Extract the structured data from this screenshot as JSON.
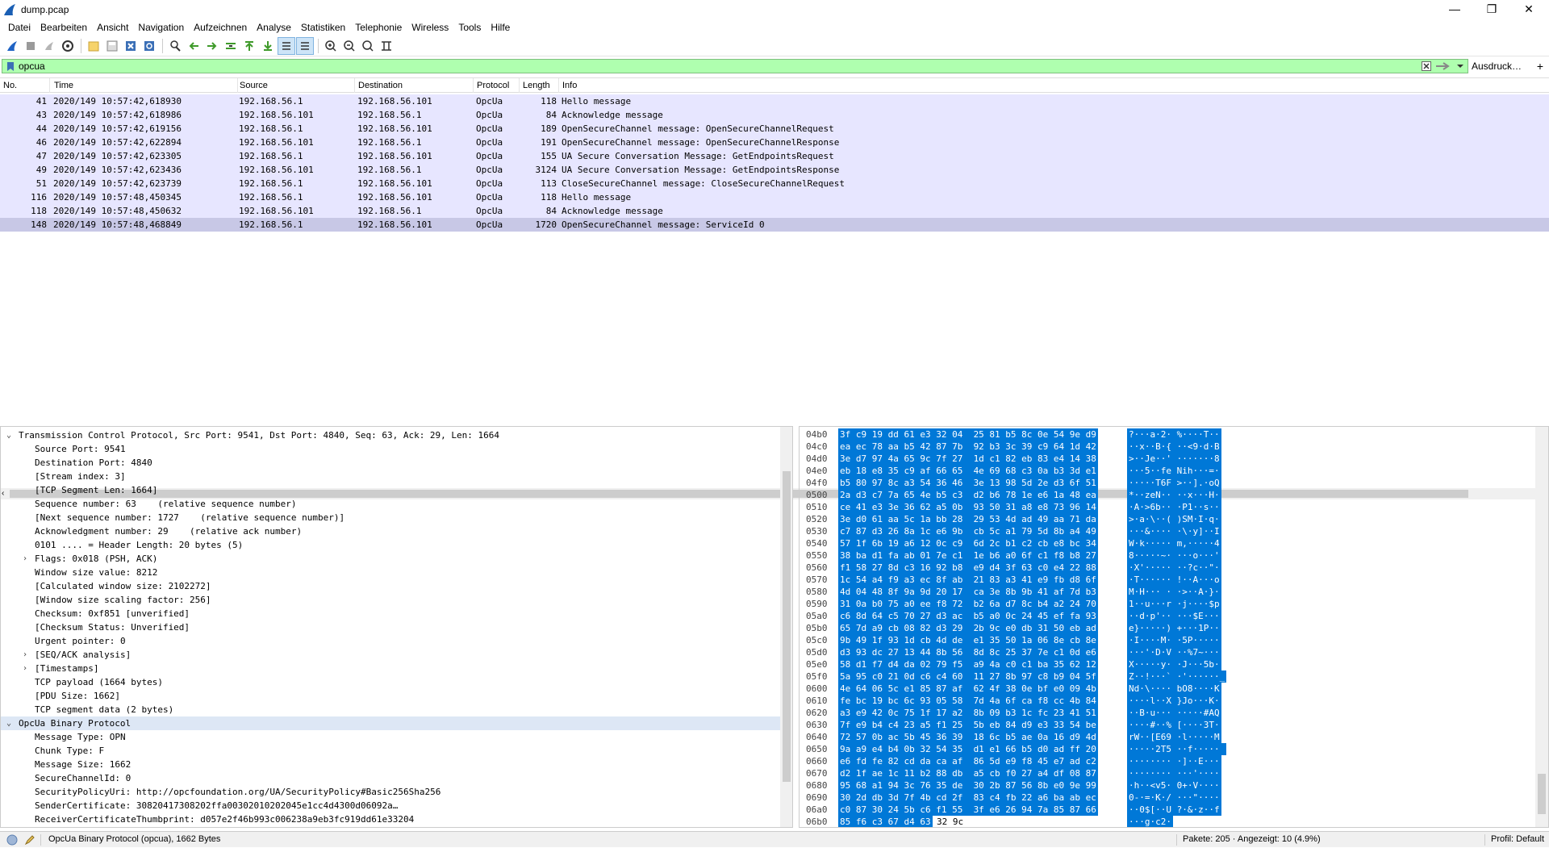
{
  "window": {
    "title": "dump.pcap",
    "minimize": "—",
    "restore": "❐",
    "close": "✕"
  },
  "menu": [
    "Datei",
    "Bearbeiten",
    "Ansicht",
    "Navigation",
    "Aufzeichnen",
    "Analyse",
    "Statistiken",
    "Telephonie",
    "Wireless",
    "Tools",
    "Hilfe"
  ],
  "filter": {
    "value": "opcua",
    "expression_label": "Ausdruck…",
    "plus": "+"
  },
  "packet_list": {
    "columns": [
      "No.",
      "Time",
      "Source",
      "Destination",
      "Protocol",
      "Length",
      "Info"
    ],
    "rows": [
      {
        "no": "41",
        "time": "2020/149 10:57:42,618930",
        "src": "192.168.56.1",
        "dst": "192.168.56.101",
        "proto": "OpcUa",
        "len": "118",
        "info": "Hello message"
      },
      {
        "no": "43",
        "time": "2020/149 10:57:42,618986",
        "src": "192.168.56.101",
        "dst": "192.168.56.1",
        "proto": "OpcUa",
        "len": "84",
        "info": "Acknowledge message"
      },
      {
        "no": "44",
        "time": "2020/149 10:57:42,619156",
        "src": "192.168.56.1",
        "dst": "192.168.56.101",
        "proto": "OpcUa",
        "len": "189",
        "info": "OpenSecureChannel message: OpenSecureChannelRequest"
      },
      {
        "no": "46",
        "time": "2020/149 10:57:42,622894",
        "src": "192.168.56.101",
        "dst": "192.168.56.1",
        "proto": "OpcUa",
        "len": "191",
        "info": "OpenSecureChannel message: OpenSecureChannelResponse"
      },
      {
        "no": "47",
        "time": "2020/149 10:57:42,623305",
        "src": "192.168.56.1",
        "dst": "192.168.56.101",
        "proto": "OpcUa",
        "len": "155",
        "info": "UA Secure Conversation Message: GetEndpointsRequest"
      },
      {
        "no": "49",
        "time": "2020/149 10:57:42,623436",
        "src": "192.168.56.101",
        "dst": "192.168.56.1",
        "proto": "OpcUa",
        "len": "3124",
        "info": "UA Secure Conversation Message: GetEndpointsResponse"
      },
      {
        "no": "51",
        "time": "2020/149 10:57:42,623739",
        "src": "192.168.56.1",
        "dst": "192.168.56.101",
        "proto": "OpcUa",
        "len": "113",
        "info": "CloseSecureChannel message: CloseSecureChannelRequest"
      },
      {
        "no": "116",
        "time": "2020/149 10:57:48,450345",
        "src": "192.168.56.1",
        "dst": "192.168.56.101",
        "proto": "OpcUa",
        "len": "118",
        "info": "Hello message"
      },
      {
        "no": "118",
        "time": "2020/149 10:57:48,450632",
        "src": "192.168.56.101",
        "dst": "192.168.56.1",
        "proto": "OpcUa",
        "len": "84",
        "info": "Acknowledge message"
      },
      {
        "no": "148",
        "time": "2020/149 10:57:48,468849",
        "src": "192.168.56.1",
        "dst": "192.168.56.101",
        "proto": "OpcUa",
        "len": "1720",
        "info": "OpenSecureChannel message: ServiceId 0"
      }
    ]
  },
  "details": [
    {
      "text": "Transmission Control Protocol, Src Port: 9541, Dst Port: 4840, Seq: 63, Ack: 29, Len: 1664",
      "level": 0,
      "arrow": "down"
    },
    {
      "text": "Source Port: 9541",
      "level": 1
    },
    {
      "text": "Destination Port: 4840",
      "level": 1
    },
    {
      "text": "[Stream index: 3]",
      "level": 1
    },
    {
      "text": "[TCP Segment Len: 1664]",
      "level": 1
    },
    {
      "text": "Sequence number: 63    (relative sequence number)",
      "level": 1
    },
    {
      "text": "[Next sequence number: 1727    (relative sequence number)]",
      "level": 1
    },
    {
      "text": "Acknowledgment number: 29    (relative ack number)",
      "level": 1
    },
    {
      "text": "0101 .... = Header Length: 20 bytes (5)",
      "level": 1
    },
    {
      "text": "Flags: 0x018 (PSH, ACK)",
      "level": 1,
      "arrow": "right"
    },
    {
      "text": "Window size value: 8212",
      "level": 1
    },
    {
      "text": "[Calculated window size: 2102272]",
      "level": 1
    },
    {
      "text": "[Window size scaling factor: 256]",
      "level": 1
    },
    {
      "text": "Checksum: 0xf851 [unverified]",
      "level": 1
    },
    {
      "text": "[Checksum Status: Unverified]",
      "level": 1
    },
    {
      "text": "Urgent pointer: 0",
      "level": 1
    },
    {
      "text": "[SEQ/ACK analysis]",
      "level": 1,
      "arrow": "right"
    },
    {
      "text": "[Timestamps]",
      "level": 1,
      "arrow": "right"
    },
    {
      "text": "TCP payload (1664 bytes)",
      "level": 1
    },
    {
      "text": "[PDU Size: 1662]",
      "level": 1
    },
    {
      "text": "TCP segment data (2 bytes)",
      "level": 1
    },
    {
      "text": "OpcUa Binary Protocol",
      "level": 0,
      "arrow": "down",
      "highlight": true
    },
    {
      "text": "Message Type: OPN",
      "level": 1
    },
    {
      "text": "Chunk Type: F",
      "level": 1
    },
    {
      "text": "Message Size: 1662",
      "level": 1
    },
    {
      "text": "SecureChannelId: 0",
      "level": 1
    },
    {
      "text": "SecurityPolicyUri: http://opcfoundation.org/UA/SecurityPolicy#Basic256Sha256",
      "level": 1
    },
    {
      "text": "SenderCertificate: 30820417308202ffa00302010202045e1cc4d4300d06092a…",
      "level": 1
    },
    {
      "text": "ReceiverCertificateThumbprint: d057e2f46b993c006238a9eb3fc919dd61e33204",
      "level": 1
    }
  ],
  "bytes": [
    {
      "off": "04b0",
      "hex": "3f c9 19 dd 61 e3 32 04  25 81 b5 8c 0e 54 9e d9",
      "asc": "?···a·2· %····T··"
    },
    {
      "off": "04c0",
      "hex": "ea ec 78 aa b5 42 87 7b  92 b3 3c 39 c9 64 1d 42",
      "asc": "··x··B·{ ··<9·d·B"
    },
    {
      "off": "04d0",
      "hex": "3e d7 97 4a 65 9c 7f 27  1d c1 82 eb 83 e4 14 38",
      "asc": ">··Je··' ·······8"
    },
    {
      "off": "04e0",
      "hex": "eb 18 e8 35 c9 af 66 65  4e 69 68 c3 0a b3 3d e1",
      "asc": "···5··fe Nih···=·"
    },
    {
      "off": "04f0",
      "hex": "b5 80 97 8c a3 54 36 46  3e 13 98 5d 2e d3 6f 51",
      "asc": "·····T6F >··].·oQ"
    },
    {
      "off": "0500",
      "hex": "2a d3 c7 7a 65 4e b5 c3  d2 b6 78 1e e6 1a 48 ea",
      "asc": "*··zeN·· ··x···H·"
    },
    {
      "off": "0510",
      "hex": "ce 41 e3 3e 36 62 a5 0b  93 50 31 a8 e8 73 96 14",
      "asc": "·A·>6b·· ·P1··s··"
    },
    {
      "off": "0520",
      "hex": "3e d0 61 aa 5c 1a bb 28  29 53 4d ad 49 aa 71 da",
      "asc": ">·a·\\··( )SM·I·q·"
    },
    {
      "off": "0530",
      "hex": "c7 87 d3 26 8a 1c e6 9b  cb 5c a1 79 5d 8b a4 49",
      "asc": "···&···· ·\\·y]··I"
    },
    {
      "off": "0540",
      "hex": "57 1f 6b 19 a6 12 0c c9  6d 2c b1 c2 cb e8 bc 34",
      "asc": "W·k····· m,·····4"
    },
    {
      "off": "0550",
      "hex": "38 ba d1 fa ab 01 7e c1  1e b6 a0 6f c1 f8 b8 27",
      "asc": "8·····~· ···o···'"
    },
    {
      "off": "0560",
      "hex": "f1 58 27 8d c3 16 92 b8  e9 d4 3f 63 c0 e4 22 88",
      "asc": "·X'····· ··?c··\"·"
    },
    {
      "off": "0570",
      "hex": "1c 54 a4 f9 a3 ec 8f ab  21 83 a3 41 e9 fb d8 6f",
      "asc": "·T······ !··A···o"
    },
    {
      "off": "0580",
      "hex": "4d 04 48 8f 9a 9d 20 17  ca 3e 8b 9b 41 af 7d b3",
      "asc": "M·H··· · ·>··A·}·"
    },
    {
      "off": "0590",
      "hex": "31 0a b0 75 a0 ee f8 72  b2 6a d7 8c b4 a2 24 70",
      "asc": "1··u···r ·j····$p"
    },
    {
      "off": "05a0",
      "hex": "c6 8d 64 c5 70 27 d3 ac  b5 a0 0c 24 45 ef fa 93",
      "asc": "··d·p'·· ···$E···"
    },
    {
      "off": "05b0",
      "hex": "65 7d a9 cb 08 82 d3 29  2b 9c e0 db 31 50 eb ad",
      "asc": "e}·····) +···1P··"
    },
    {
      "off": "05c0",
      "hex": "9b 49 1f 93 1d cb 4d de  e1 35 50 1a 06 8e cb 8e",
      "asc": "·I····M· ·5P·····"
    },
    {
      "off": "05d0",
      "hex": "d3 93 dc 27 13 44 8b 56  8d 8c 25 37 7e c1 0d e6",
      "asc": "···'·D·V ··%7~···"
    },
    {
      "off": "05e0",
      "hex": "58 d1 f7 d4 da 02 79 f5  a9 4a c0 c1 ba 35 62 12",
      "asc": "X·····y· ·J···5b·"
    },
    {
      "off": "05f0",
      "hex": "5a 95 c0 21 0d c6 c4 60  11 27 8b 97 c8 b9 04 5f",
      "asc": "Z··!···` ·'······_"
    },
    {
      "off": "0600",
      "hex": "4e 64 06 5c e1 85 87 af  62 4f 38 0e bf e0 09 4b",
      "asc": "Nd·\\···· bO8····K"
    },
    {
      "off": "0610",
      "hex": "fe bc 19 bc 6c 93 05 58  7d 4a 6f ca f8 cc 4b 84",
      "asc": "····l··X }Jo···K·"
    },
    {
      "off": "0620",
      "hex": "a3 e9 42 0c 75 1f 17 a2  8b 09 b3 1c fc 23 41 51",
      "asc": "··B·u··· ·····#AQ"
    },
    {
      "off": "0630",
      "hex": "7f e9 b4 c4 23 a5 f1 25  5b eb 84 d9 e3 33 54 be",
      "asc": "····#··% [····3T·"
    },
    {
      "off": "0640",
      "hex": "72 57 0b ac 5b 45 36 39  18 6c b5 ae 0a 16 d9 4d",
      "asc": "rW··[E69 ·l·····M"
    },
    {
      "off": "0650",
      "hex": "9a a9 e4 b4 0b 32 54 35  d1 e1 66 b5 d0 ad ff 20",
      "asc": "·····2T5 ··f····· "
    },
    {
      "off": "0660",
      "hex": "e6 fd fe 82 cd da ca af  86 5d e9 f8 45 e7 ad c2",
      "asc": "········ ·]··E···"
    },
    {
      "off": "0670",
      "hex": "d2 1f ae 1c 11 b2 88 db  a5 cb f0 27 a4 df 08 87",
      "asc": "········ ···'····"
    },
    {
      "off": "0680",
      "hex": "95 68 a1 94 3c 76 35 de  30 2b 87 56 8b e0 9e 99",
      "asc": "·h··<v5· 0+·V····"
    },
    {
      "off": "0690",
      "hex": "30 2d db 3d 7f 4b cd 2f  83 c4 fb 22 a6 ba ab ec",
      "asc": "0-·=·K·/ ···\"····"
    },
    {
      "off": "06a0",
      "hex": "c0 87 30 24 5b c6 f1 55  3f e6 26 94 7a 85 87 66",
      "asc": "··0$[··U ?·&·z··f"
    },
    {
      "off": "06b0",
      "hex": "85 f6 c3 67 d4 63",
      "hexn": "32 9c",
      "asc": "···g·c2·"
    }
  ],
  "status": {
    "protocol_info": "OpcUa Binary Protocol (opcua), 1662 Bytes",
    "packets": "Pakete: 205 · Angezeigt: 10 (4.9%)",
    "profile": "Profil: Default"
  },
  "colors": {
    "row_bg": "#e7e6ff",
    "row_selected": "#c8c8e6",
    "filter_bg": "#afffaf",
    "byte_highlight": "#0078d7"
  }
}
